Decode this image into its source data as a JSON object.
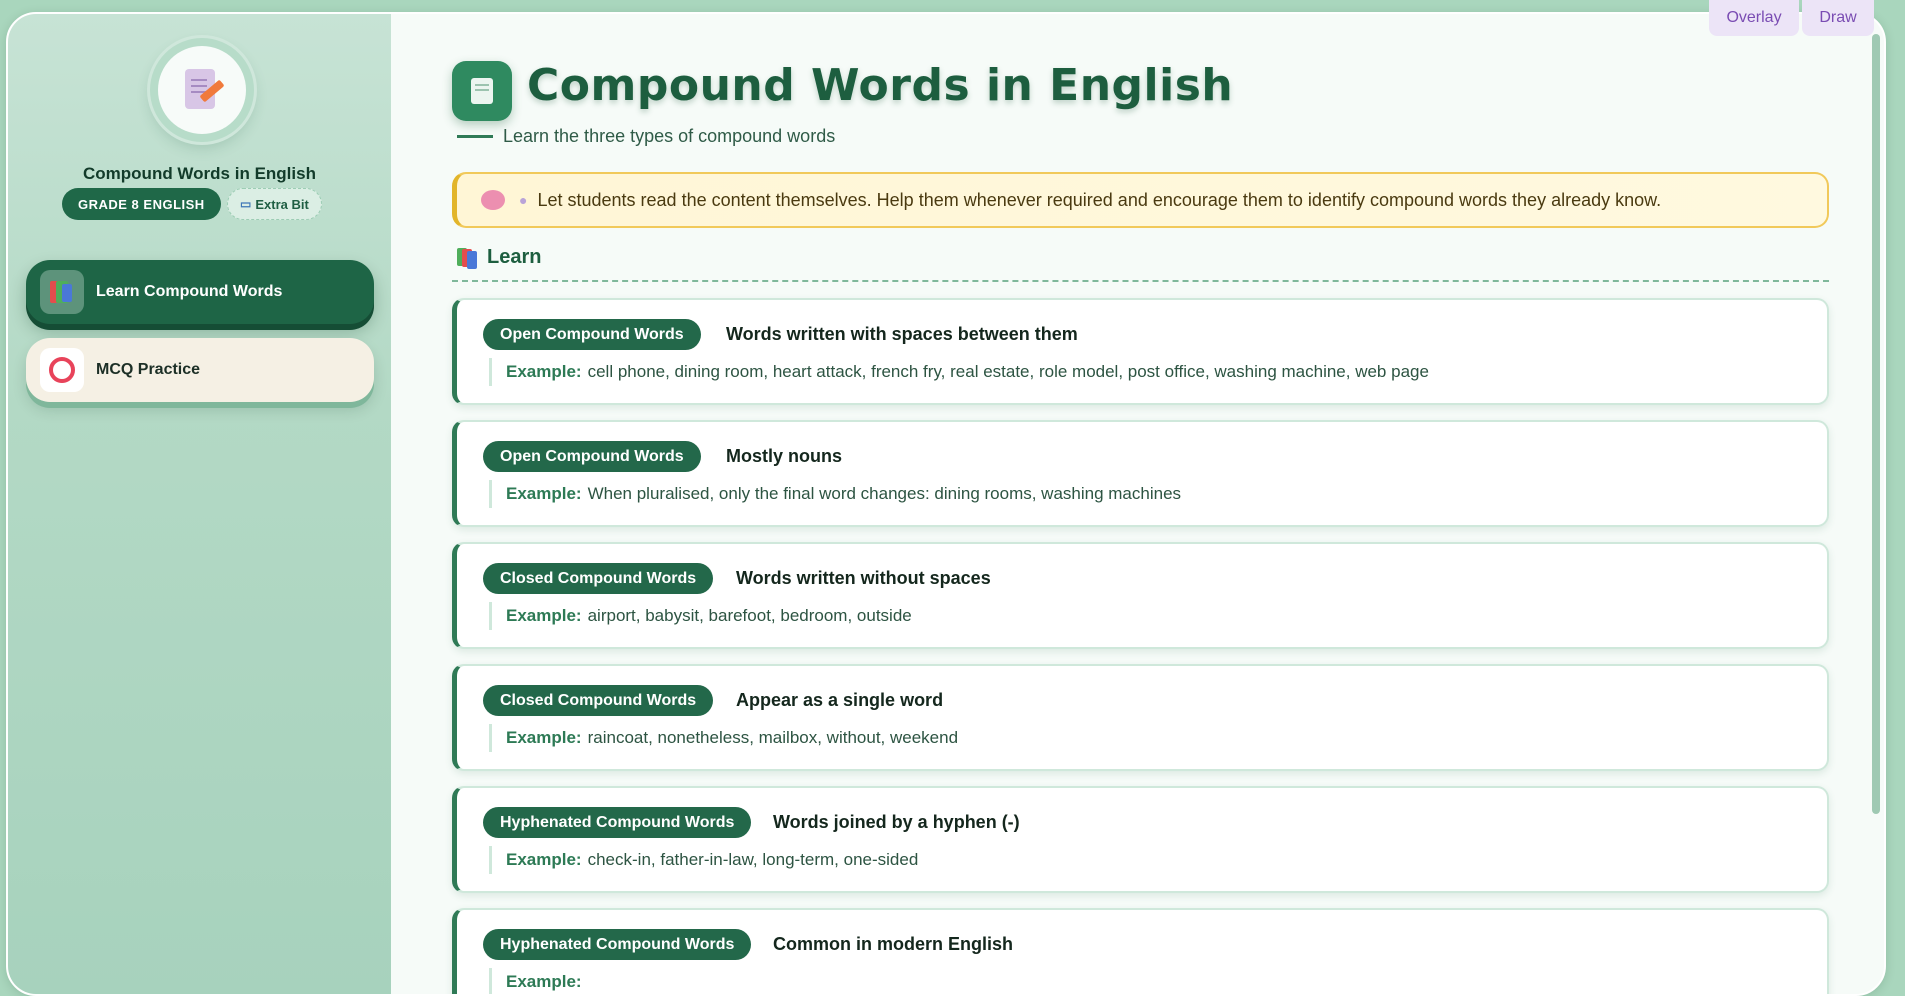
{
  "sidebar": {
    "title": "Compound Words in English",
    "grade_badge": "GRADE 8 ENGLISH",
    "extra_badge": "Extra Bit",
    "nav": [
      {
        "label": "Learn Compound Words",
        "icon": "books-icon",
        "active": true
      },
      {
        "label": "MCQ Practice",
        "icon": "ring-icon",
        "active": false
      }
    ]
  },
  "header": {
    "title": "Compound Words in English",
    "subtitle": "Learn the three types of compound words"
  },
  "note": {
    "text": "Let students read the content themselves. Help them whenever required and encourage them to identify compound words they already know."
  },
  "section": {
    "title": "Learn"
  },
  "example_label": "Example:",
  "cards": [
    {
      "tag": "Open Compound Words",
      "desc": "Words written with spaces between them",
      "example": "cell phone, dining room, heart attack, french fry, real estate, role model, post office, washing machine, web page"
    },
    {
      "tag": "Open Compound Words",
      "desc": "Mostly nouns",
      "example": "When pluralised, only the final word changes: dining rooms, washing machines"
    },
    {
      "tag": "Closed Compound Words",
      "desc": "Words written without spaces",
      "example": "airport, babysit, barefoot, bedroom, outside"
    },
    {
      "tag": "Closed Compound Words",
      "desc": "Appear as a single word",
      "example": "raincoat, nonetheless, mailbox, without, weekend"
    },
    {
      "tag": "Hyphenated Compound Words",
      "desc": "Words joined by a hyphen (-)",
      "example": "check-in, father-in-law, long-term, one-sided"
    },
    {
      "tag": "Hyphenated Compound Words",
      "desc": "Common in modern English",
      "example": ""
    }
  ],
  "toolbar": {
    "overlay": "Overlay",
    "draw": "Draw"
  },
  "colors": {
    "primary": "#1e6546",
    "accent_note": "#f1c95a",
    "sidebar_bg": "#b3d9c5"
  }
}
